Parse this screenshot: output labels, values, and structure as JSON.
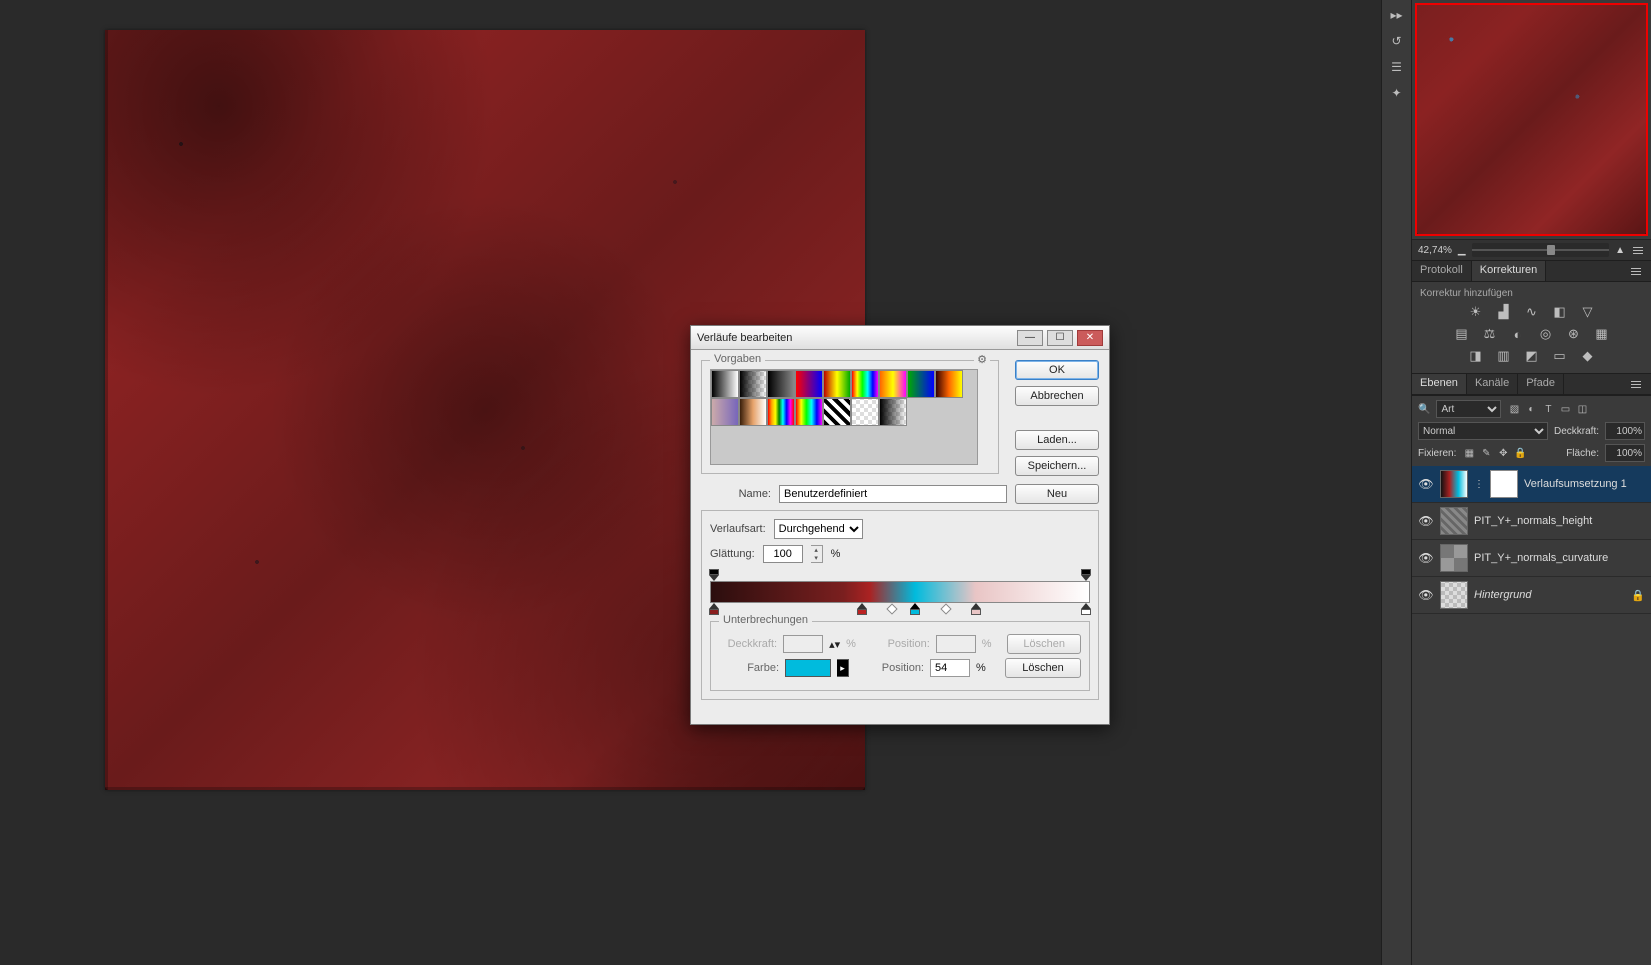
{
  "navigator": {
    "zoom_label": "42,74%"
  },
  "panel_tabs_top": {
    "tab1": "Protokoll",
    "tab2": "Korrekturen"
  },
  "adjustments": {
    "heading": "Korrektur hinzufügen"
  },
  "layer_tabs": {
    "tab1": "Ebenen",
    "tab2": "Kanäle",
    "tab3": "Pfade"
  },
  "layer_controls": {
    "filter_kind": "Art",
    "blend_mode": "Normal",
    "opacity_label": "Deckkraft:",
    "opacity_value": "100%",
    "lock_label": "Fixieren:",
    "fill_label": "Fläche:",
    "fill_value": "100%"
  },
  "layers": [
    {
      "name": "Verlaufsumsetzung 1",
      "active": true,
      "has_mask": true,
      "thumb": "grad",
      "italic": false,
      "locked": false
    },
    {
      "name": "PIT_Y+_normals_height",
      "active": false,
      "has_mask": false,
      "thumb": "gray",
      "italic": false,
      "locked": false
    },
    {
      "name": "PIT_Y+_normals_curvature",
      "active": false,
      "has_mask": false,
      "thumb": "curv",
      "italic": false,
      "locked": false
    },
    {
      "name": "Hintergrund",
      "active": false,
      "has_mask": false,
      "thumb": "bg",
      "italic": true,
      "locked": true
    }
  ],
  "dialog": {
    "title": "Verläufe bearbeiten",
    "buttons": {
      "ok": "OK",
      "cancel": "Abbrechen",
      "load": "Laden...",
      "save": "Speichern...",
      "new": "Neu",
      "delete": "Löschen"
    },
    "presets_legend": "Vorgaben",
    "name_label": "Name:",
    "name_value": "Benutzerdefiniert",
    "gradient_type_label": "Verlaufsart:",
    "gradient_type_value": "Durchgehend",
    "smoothness_label": "Glättung:",
    "smoothness_value": "100",
    "smoothness_unit": "%",
    "stops_legend": "Unterbrechungen",
    "opacity_label": "Deckkraft:",
    "opacity_unit": "%",
    "position_label": "Position:",
    "position_unit": "%",
    "color_label": "Farbe:",
    "color_position_value": "54",
    "color_swatch": "#00bbdd",
    "gradient_stops": {
      "opacity": [
        {
          "position": 0,
          "opacity": 100
        },
        {
          "position": 100,
          "opacity": 100
        }
      ],
      "color": [
        {
          "position": 0,
          "color": "#2b0e0e"
        },
        {
          "position": 40,
          "color": "#8a1f1f"
        },
        {
          "position": 54,
          "color": "#00bbdd"
        },
        {
          "position": 70,
          "color": "#e9c5c5"
        },
        {
          "position": 100,
          "color": "#ffffff"
        }
      ],
      "midpoints": [
        48,
        62
      ]
    }
  }
}
